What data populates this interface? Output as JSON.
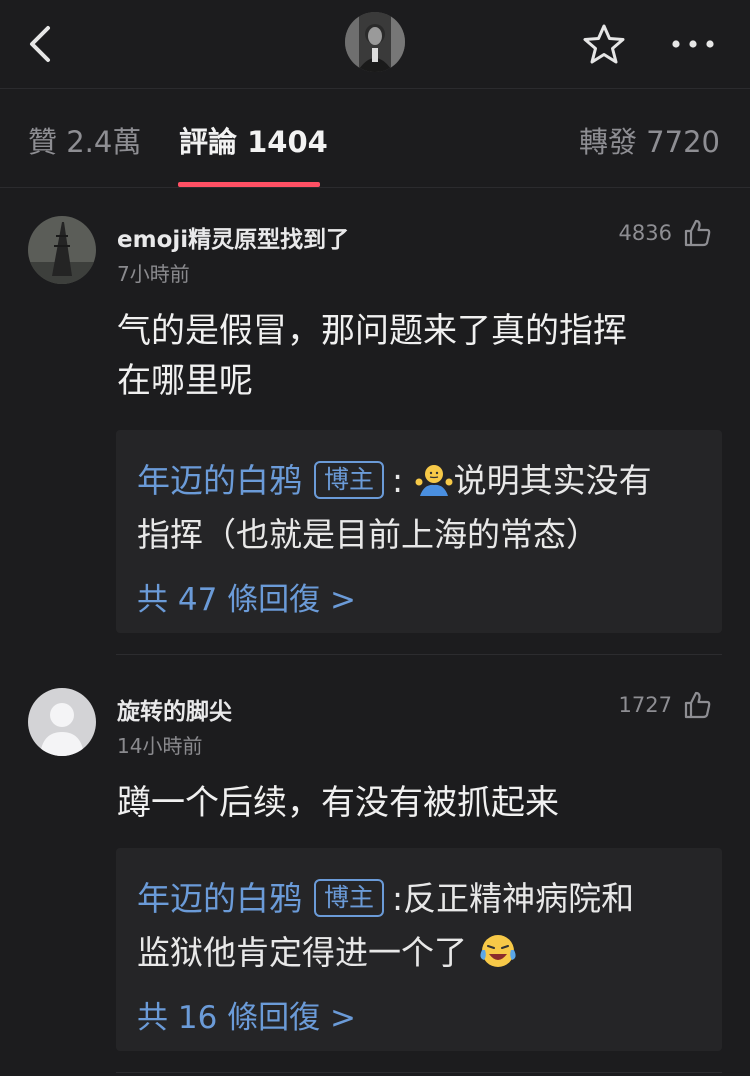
{
  "tabs": {
    "likes": "贊 2.4萬",
    "comments": "評論 1404",
    "reposts": "轉發 7720"
  },
  "comments": [
    {
      "username": "emoji精灵原型找到了",
      "time": "7小時前",
      "likes": "4836",
      "text_line1": "气的是假冒，那问题来了真的指挥",
      "text_line2": "在哪里呢",
      "reply": {
        "author": "年迈的白鸦",
        "badge": "博主",
        "sep": ":",
        "text_line1_end": "说明其实没有",
        "text_line2": "指挥（也就是目前上海的常态）",
        "more": "共 47 條回復 >"
      }
    },
    {
      "username": "旋转的脚尖",
      "time": "14小時前",
      "likes": "1727",
      "text_line1": "蹲一个后续，有没有被抓起来",
      "reply": {
        "author": "年迈的白鸦",
        "badge": "博主",
        "sep": ":",
        "text_line1_end": "反正精神病院和",
        "text_line2": "监狱他肯定得进一个了",
        "more": "共 16 條回復 >"
      }
    }
  ]
}
